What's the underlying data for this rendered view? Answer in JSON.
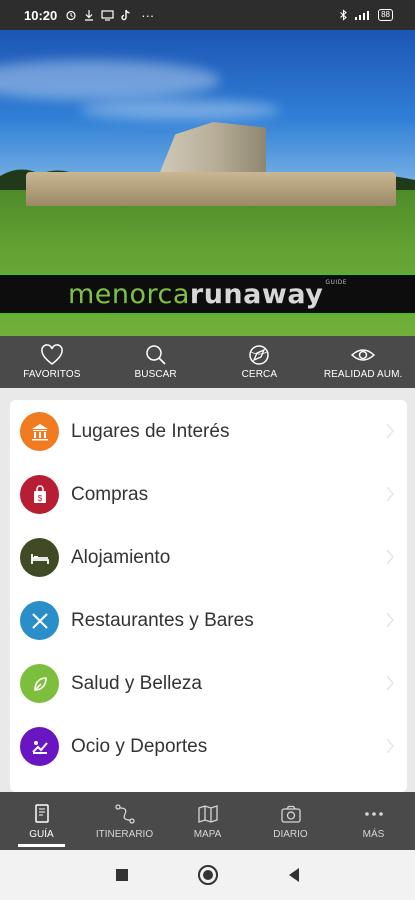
{
  "status_bar": {
    "time": "10:20",
    "icons_left": [
      "alarm-icon",
      "download-icon",
      "cast-icon",
      "tiktok-icon",
      "more-icon"
    ],
    "icons_right": [
      "bluetooth-icon",
      "signal-icon",
      "battery-icon"
    ],
    "battery_text": "88"
  },
  "hero": {
    "brand_part1": "menorca",
    "brand_part2": "runaway",
    "brand_sub": "GUIDE"
  },
  "quick_bar": {
    "items": [
      {
        "label": "FAVORITOS",
        "icon": "heart-icon"
      },
      {
        "label": "BUSCAR",
        "icon": "search-icon"
      },
      {
        "label": "CERCA",
        "icon": "compass-icon"
      },
      {
        "label": "REALIDAD AUM.",
        "icon": "eye-icon"
      }
    ]
  },
  "categories": [
    {
      "label": "Lugares de Interés",
      "icon": "museum-icon",
      "color": "#f07b21"
    },
    {
      "label": "Compras",
      "icon": "shopping-bag-icon",
      "color": "#b81e33"
    },
    {
      "label": "Alojamiento",
      "icon": "bed-icon",
      "color": "#404a24"
    },
    {
      "label": "Restaurantes y Bares",
      "icon": "cutlery-icon",
      "color": "#2a8ec9"
    },
    {
      "label": "Salud y Belleza",
      "icon": "leaf-icon",
      "color": "#7dbf3d"
    },
    {
      "label": "Ocio y Deportes",
      "icon": "leisure-icon",
      "color": "#6a15c2"
    }
  ],
  "bottom_nav": {
    "items": [
      {
        "label": "GUÍA",
        "icon": "book-icon",
        "active": true
      },
      {
        "label": "ITINERARIO",
        "icon": "route-icon",
        "active": false
      },
      {
        "label": "MAPA",
        "icon": "map-icon",
        "active": false
      },
      {
        "label": "DIARIO",
        "icon": "camera-icon",
        "active": false
      },
      {
        "label": "MÁS",
        "icon": "more-icon",
        "active": false
      }
    ]
  },
  "system_nav": [
    "recents-button",
    "home-button",
    "back-button"
  ],
  "colors": {
    "accent_green": "#4fb82b",
    "bar_dark": "#4a4a4a"
  }
}
